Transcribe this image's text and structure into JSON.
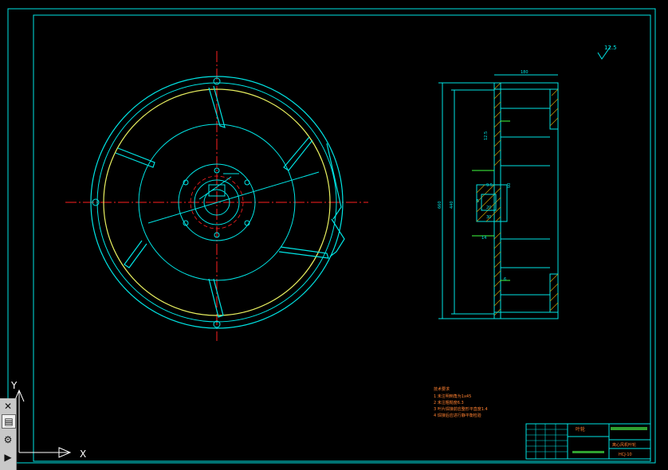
{
  "colors": {
    "background": "#000000",
    "frame": "#00e5e5",
    "centerline": "#ff2020",
    "yellow_circle": "#e8f060",
    "dimension": "#40ff40",
    "hatch": "#c8a000",
    "notes": "#ff8030",
    "titleblock_fill": "#30a030",
    "axis": "#ffffff"
  },
  "drawing": {
    "side_view": {
      "dims": [
        "180",
        "660",
        "440",
        "5",
        "12.5",
        "9.5",
        "20",
        "60",
        "30",
        "14",
        "6"
      ]
    },
    "roughness": {
      "value": "12.5"
    },
    "tech_notes": {
      "title": "技术要求",
      "lines": [
        "1 未注明倒角为1x45",
        "2 未注粗糙度6.3",
        "3 叶片焊接前应整形平直度1.4",
        "4 焊接后应进行静平衡检验"
      ]
    },
    "title_block": {
      "part_name": "叶轮",
      "drawing_name": "离心风机叶轮",
      "code": "HCJ-10"
    }
  },
  "ucs": {
    "x_label": "X",
    "y_label": "Y"
  },
  "toolbar": {
    "icons": [
      "close-icon",
      "layout-icon",
      "properties-icon",
      "play-icon"
    ]
  }
}
